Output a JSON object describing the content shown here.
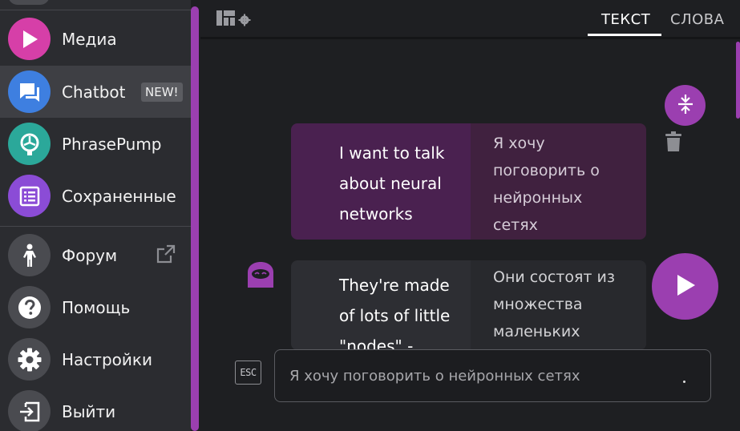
{
  "sidebar": {
    "items": [
      {
        "label": "Медиа",
        "icon": "play-icon",
        "color": "#d63fa8"
      },
      {
        "label": "Chatbot",
        "icon": "chat-icon",
        "color": "#3e7fe0",
        "badge": "NEW!"
      },
      {
        "label": "PhrasePump",
        "icon": "pump-icon",
        "color": "#2ba89a"
      },
      {
        "label": "Сохраненные",
        "icon": "list-icon",
        "color": "#8b4cd6"
      },
      {
        "label": "Форум",
        "icon": "person-icon",
        "color": "#4a4b50"
      },
      {
        "label": "Помощь",
        "icon": "help-icon",
        "color": "#4a4b50"
      },
      {
        "label": "Настройки",
        "icon": "gear-icon",
        "color": "#4a4b50"
      },
      {
        "label": "Выйти",
        "icon": "logout-icon",
        "color": "#4a4b50"
      }
    ]
  },
  "tabs": {
    "text": "ТЕКСТ",
    "words": "СЛОВА",
    "active": "text"
  },
  "messages": [
    {
      "source": "I want to talk about neural networks",
      "translation": "Я хочу поговорить о нейронных сетях",
      "from": "user"
    },
    {
      "source": "They're made of lots of little \"nodes\" -",
      "translation": "Они состоят из множества маленьких",
      "from": "bot"
    }
  ],
  "input": {
    "esc_label": "ESC",
    "placeholder": "Я хочу поговорить о нейронных сетях"
  },
  "colors": {
    "accent": "#9b3fb0",
    "user_bubble": "#4a2150",
    "bot_bubble": "#2d2e33"
  }
}
